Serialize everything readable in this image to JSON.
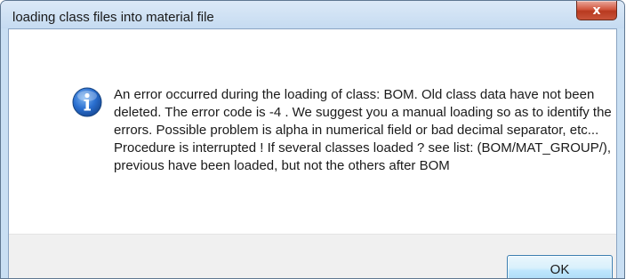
{
  "dialog": {
    "title": "loading class files into material file",
    "close_glyph": "x",
    "icon": "info-icon",
    "message": "An error occurred during the loading of class: BOM. Old class data have not been deleted. The error code is -4 . We suggest you a manual loading so as to identify the errors. Possible problem is alpha in numerical field or bad decimal separator, etc... Procedure is interrupted ! If several classes loaded ? see list: (BOM/MAT_GROUP/), previous have been loaded, but not the others after BOM",
    "ok_label": "OK"
  },
  "colors": {
    "titlebar": "#c9dff3",
    "close_button": "#c8533a",
    "icon_blue": "#1e63c4",
    "footer": "#f0f0f0"
  }
}
